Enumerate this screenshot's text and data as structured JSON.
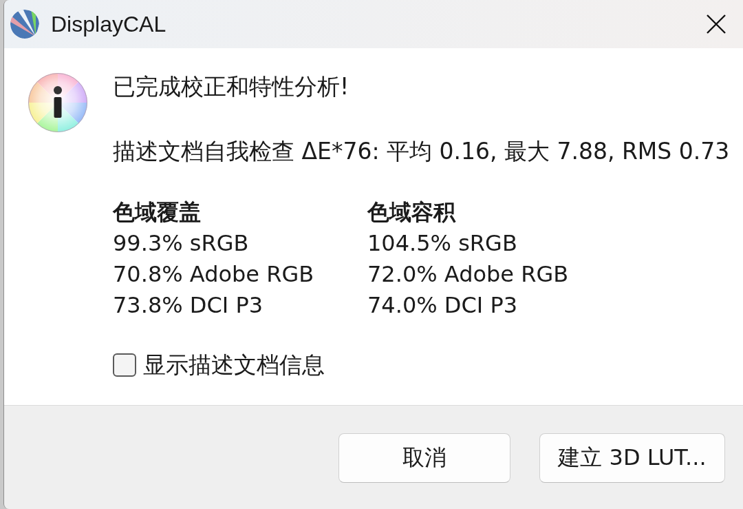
{
  "window": {
    "title": "DisplayCAL"
  },
  "message": {
    "heading": "已完成校正和特性分析!",
    "self_check": "描述文档自我检查 ΔE*76: 平均 0.16, 最大 7.88, RMS 0.73"
  },
  "gamut": [
    {
      "title": "色域覆盖",
      "values": [
        "99.3% sRGB",
        "70.8% Adobe RGB",
        "73.8% DCI P3"
      ]
    },
    {
      "title": "色域容积",
      "values": [
        "104.5% sRGB",
        "72.0% Adobe RGB",
        "74.0% DCI P3"
      ]
    }
  ],
  "checkbox": {
    "label": "显示描述文档信息",
    "checked": false
  },
  "buttons": [
    {
      "label": "取消"
    },
    {
      "label": "建立 3D LUT..."
    }
  ]
}
